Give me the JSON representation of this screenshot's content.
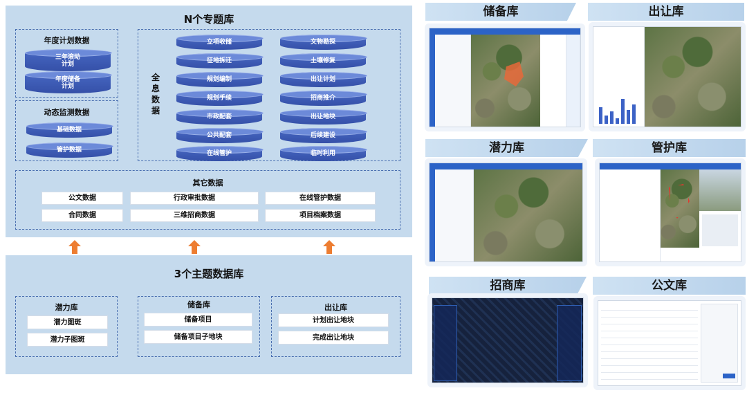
{
  "thematic_libraries": {
    "title": "N个专题库",
    "annual_plan": {
      "title": "年度计划数据",
      "items": [
        "三年滚动\n计划",
        "年度储备\n计划"
      ]
    },
    "dynamic_monitoring": {
      "title": "动态监测数据",
      "items": [
        "基础数据",
        "管护数据"
      ]
    },
    "full_data": {
      "label": "全\n息\n数\n据",
      "left_items": [
        "立项收储",
        "征地拆迁",
        "规划编制",
        "规划手续",
        "市政配套",
        "公共配套",
        "在线管护"
      ],
      "right_items": [
        "文物勘探",
        "土壤修复",
        "出让计划",
        "招商推介",
        "出让地块",
        "后续建设",
        "临时利用"
      ]
    },
    "other_data": {
      "title": "其它数据",
      "rows": [
        [
          "公文数据",
          "行政审批数据",
          "在线管护数据"
        ],
        [
          "合同数据",
          "三维招商数据",
          "项目档案数据"
        ]
      ]
    }
  },
  "topic_databases": {
    "title": "3个主题数据库",
    "groups": [
      {
        "name": "潜力库",
        "items": [
          "潜力图斑",
          "潜力子图斑"
        ]
      },
      {
        "name": "储备库",
        "items": [
          "储备项目",
          "储备项目子地块"
        ]
      },
      {
        "name": "出让库",
        "items": [
          "计划出让地块",
          "完成出让地块"
        ]
      }
    ]
  },
  "screenshots": [
    {
      "label": "储备库"
    },
    {
      "label": "出让库"
    },
    {
      "label": "潜力库"
    },
    {
      "label": "管护库"
    },
    {
      "label": "招商库"
    },
    {
      "label": "公文库"
    }
  ],
  "colors": {
    "panel": "#c5daed",
    "cylinder": "#3b57b0",
    "arrow": "#ed7d31",
    "dash_border": "#4a6fb0"
  },
  "icons": [
    "up-arrow-icon",
    "database-cylinder-icon"
  ]
}
